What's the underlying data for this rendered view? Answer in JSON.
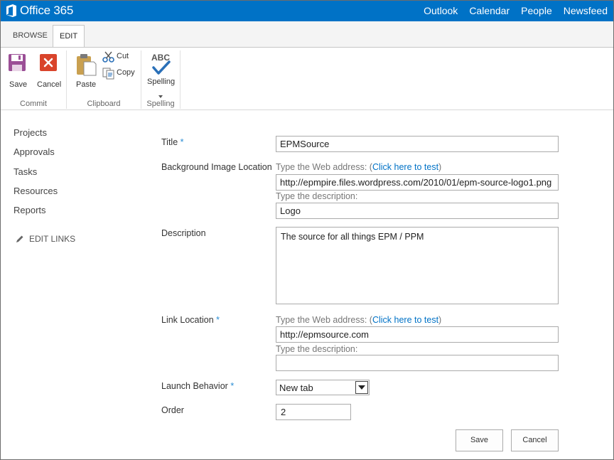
{
  "suite_bar": {
    "brand": "Office 365",
    "nav": [
      "Outlook",
      "Calendar",
      "People",
      "Newsfeed"
    ]
  },
  "ribbon": {
    "tabs": [
      "BROWSE",
      "EDIT"
    ],
    "active_tab": "EDIT",
    "commit": {
      "label": "Commit",
      "save": "Save",
      "cancel": "Cancel"
    },
    "clipboard": {
      "label": "Clipboard",
      "paste": "Paste",
      "cut": "Cut",
      "copy": "Copy"
    },
    "spelling": {
      "label": "Spelling",
      "button": "Spelling",
      "icon_text": "ABC"
    }
  },
  "left_nav": {
    "items": [
      "Projects",
      "Approvals",
      "Tasks",
      "Resources",
      "Reports"
    ],
    "edit_links": "EDIT LINKS"
  },
  "form": {
    "title": {
      "label": "Title",
      "required": "*",
      "value": "EPMSource"
    },
    "background_image": {
      "label": "Background Image Location",
      "web_address_hint": "Type the Web address: (",
      "test_link": "Click here to test",
      "hint_close": ")",
      "url_value": "http://epmpire.files.wordpress.com/2010/01/epm-source-logo1.png",
      "description_hint": "Type the description:",
      "description_value": "Logo"
    },
    "description": {
      "label": "Description",
      "value": "The source for all things EPM / PPM"
    },
    "link_location": {
      "label": "Link Location",
      "required": "*",
      "web_address_hint": "Type the Web address: (",
      "test_link": "Click here to test",
      "hint_close": ")",
      "url_value": "http://epmsource.com",
      "description_hint": "Type the description:",
      "description_value": ""
    },
    "launch_behavior": {
      "label": "Launch Behavior",
      "required": "*",
      "value": "New tab"
    },
    "order": {
      "label": "Order",
      "value": "2"
    },
    "buttons": {
      "save": "Save",
      "cancel": "Cancel"
    }
  },
  "colors": {
    "suite_bar": "#0072c6",
    "link": "#0072c6",
    "required": "#2a8dd4",
    "save_icon": "#9b4f96",
    "cancel_icon": "#d9442b",
    "spelling_check": "#2a70b8"
  }
}
